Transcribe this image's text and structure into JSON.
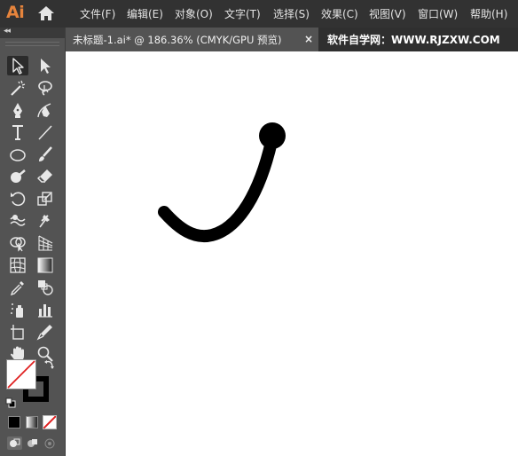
{
  "app": {
    "logo_text": "Ai"
  },
  "menu": {
    "items": [
      "文件(F)",
      "编辑(E)",
      "对象(O)",
      "文字(T)",
      "选择(S)",
      "效果(C)",
      "视图(V)",
      "窗口(W)",
      "帮助(H)"
    ]
  },
  "document_tab": {
    "title": "未标题-1.ai* @ 186.36% (CMYK/GPU 预览)",
    "close_glyph": "×"
  },
  "watermark": "软件自学网：WWW.RJZXW.COM",
  "toolbar": {
    "collapse_glyph": "◂◂",
    "tools": [
      "selection-tool",
      "direct-selection-tool",
      "magic-wand-tool",
      "lasso-tool",
      "pen-tool",
      "curvature-tool",
      "type-tool",
      "line-segment-tool",
      "ellipse-tool",
      "paintbrush-tool",
      "shaper-tool",
      "eraser-tool",
      "rotate-tool",
      "scale-tool",
      "warp-tool",
      "puppet-warp-tool",
      "shape-builder-tool",
      "perspective-grid-tool",
      "mesh-tool",
      "gradient-tool",
      "eyedropper-tool",
      "blend-tool",
      "symbol-sprayer-tool",
      "column-graph-tool",
      "artboard-tool",
      "slice-tool",
      "hand-tool",
      "zoom-tool"
    ],
    "fill": "none",
    "stroke": "#000000"
  },
  "artwork": {
    "stroke_color": "#000000",
    "description_shapes": [
      "curved-stroke-path",
      "endpoint-dot"
    ]
  }
}
